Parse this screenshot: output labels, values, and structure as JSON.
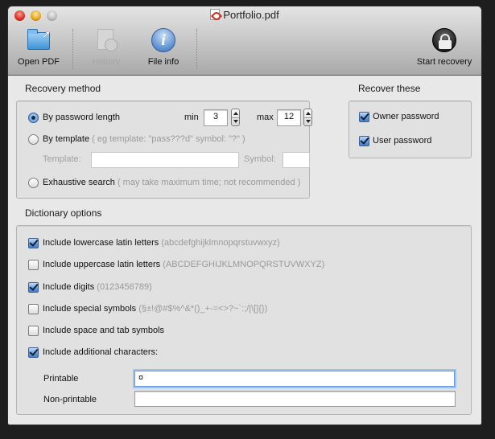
{
  "window": {
    "title": "Portfolio.pdf"
  },
  "toolbar": {
    "open_pdf": "Open PDF",
    "history": "History",
    "file_info": "File info",
    "start_recovery": "Start recovery"
  },
  "recovery_method": {
    "title": "Recovery method",
    "by_length": {
      "label": "By password length",
      "selected": true
    },
    "min_label": "min",
    "min_value": "3",
    "max_label": "max",
    "max_value": "12",
    "by_template": {
      "label": "By template",
      "hint": "( eg template: \"pass???d\" symbol: \"?\" )",
      "selected": false
    },
    "template_label": "Template:",
    "template_value": "",
    "symbol_label": "Symbol:",
    "symbol_value": "",
    "exhaustive": {
      "label": "Exhaustive search",
      "hint": "( may take maximum time; not recommended )",
      "selected": false
    }
  },
  "recover_these": {
    "title": "Recover these",
    "owner": {
      "label": "Owner password",
      "checked": true
    },
    "user": {
      "label": "User password",
      "checked": true
    }
  },
  "dictionary": {
    "title": "Dictionary options",
    "items": [
      {
        "label": "Include lowercase latin letters",
        "hint": "(abcdefghijklmnopqrstuvwxyz)",
        "checked": true
      },
      {
        "label": "Include uppercase latin letters",
        "hint": "(ABCDEFGHIJKLMNOPQRSTUVWXYZ)",
        "checked": false
      },
      {
        "label": "Include digits",
        "hint": "(0123456789)",
        "checked": true
      },
      {
        "label": "Include special symbols",
        "hint": "(§±!@#$%^&*()_+-=<>?~`:;/|\\[]{})",
        "checked": false
      },
      {
        "label": "Include space and tab symbols",
        "hint": "",
        "checked": false
      },
      {
        "label": "Include additional characters:",
        "hint": "",
        "checked": true
      }
    ],
    "printable_label": "Printable",
    "printable_value": "¤",
    "nonprintable_label": "Non-printable",
    "nonprintable_value": ""
  },
  "colors": {
    "accent": "#5f9ade",
    "window_bg": "#e8e8e8",
    "focus_ring": "#9ec3f0"
  }
}
